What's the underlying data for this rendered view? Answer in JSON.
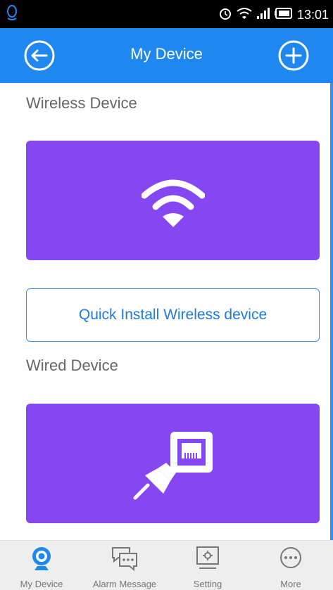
{
  "status_bar": {
    "time": "13:01",
    "icons": [
      "app-notification-icon",
      "alarm-clock-icon",
      "wifi-icon",
      "signal-icon",
      "battery-icon"
    ]
  },
  "header": {
    "title": "My Device",
    "back_icon": "back-arrow-icon",
    "add_icon": "plus-circle-icon",
    "color": "#1e88f0"
  },
  "sections": {
    "wireless_title": "Wireless Device",
    "wireless_card_icon": "wifi-icon",
    "quick_install_label": "Quick Install Wireless device",
    "wired_title": "Wired Device",
    "wired_card_icon": "ethernet-plug-icon",
    "card_color": "#8447f2"
  },
  "tabs": [
    {
      "label": "My Device",
      "icon": "camera-icon",
      "active": true
    },
    {
      "label": "Alarm Message",
      "icon": "chat-bubbles-icon",
      "active": false
    },
    {
      "label": "Setting",
      "icon": "monitor-settings-icon",
      "active": false
    },
    {
      "label": "More",
      "icon": "more-dots-icon",
      "active": false
    }
  ]
}
